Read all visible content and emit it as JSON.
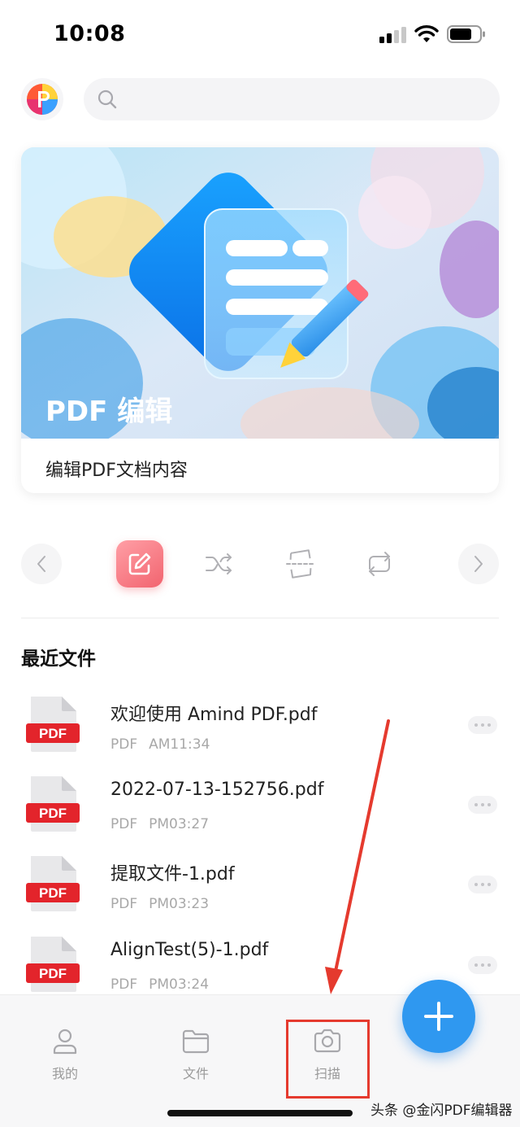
{
  "status_bar": {
    "time": "10:08"
  },
  "search": {
    "placeholder": ""
  },
  "banner": {
    "title": "PDF 编辑",
    "subtitle": "编辑PDF文档内容"
  },
  "tools": {
    "items": [
      {
        "icon": "edit-icon",
        "active": true
      },
      {
        "icon": "shuffle-icon",
        "active": false
      },
      {
        "icon": "crop-icon",
        "active": false
      },
      {
        "icon": "rotate-icon",
        "active": false
      }
    ]
  },
  "recent": {
    "title": "最近文件",
    "files": [
      {
        "name": "欢迎使用 Amind PDF.pdf",
        "type": "PDF",
        "time": "AM11:34",
        "badge": "PDF"
      },
      {
        "name": "2022-07-13-152756.pdf",
        "type": "PDF",
        "time": "PM03:27",
        "badge": "PDF"
      },
      {
        "name": "提取文件-1.pdf",
        "type": "PDF",
        "time": "PM03:23",
        "badge": "PDF"
      },
      {
        "name": "AlignTest(5)-1.pdf",
        "type": "PDF",
        "time": "PM03:24",
        "badge": "PDF"
      }
    ]
  },
  "tabbar": {
    "items": [
      {
        "label": "我的",
        "icon": "person-icon"
      },
      {
        "label": "文件",
        "icon": "folder-icon"
      },
      {
        "label": "扫描",
        "icon": "camera-icon"
      }
    ]
  },
  "watermark": "头条 @金闪PDF编辑器",
  "colors": {
    "accent": "#2f98f0",
    "pdf_red": "#e3242b",
    "highlight": "#e53a2e"
  }
}
